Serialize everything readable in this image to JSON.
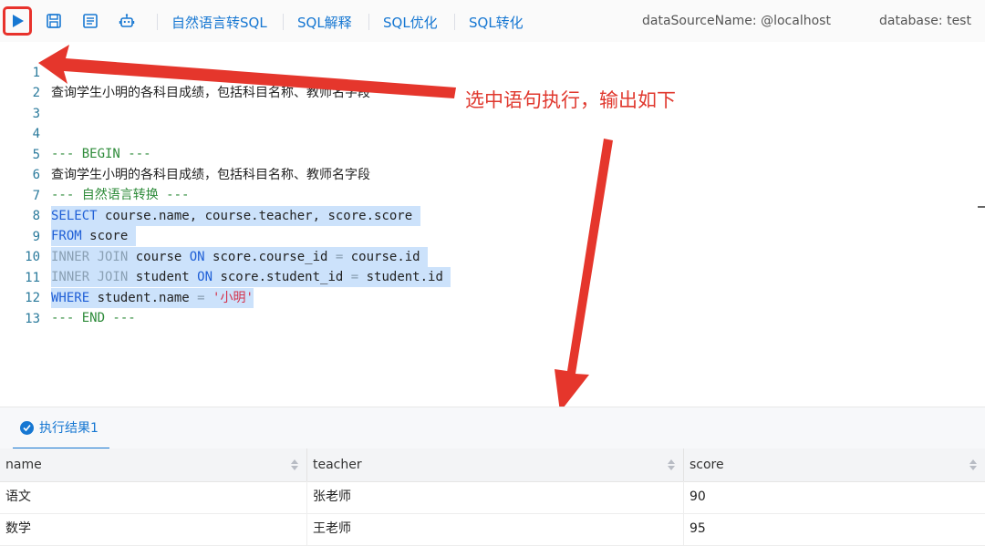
{
  "toolbar": {
    "links": [
      "自然语言转SQL",
      "SQL解释",
      "SQL优化",
      "SQL转化"
    ],
    "datasource": "dataSourceName: @localhost",
    "database": "database: test"
  },
  "editor": {
    "lines": [
      {
        "n": "1",
        "text": "查询学生小明的各科目成绩，包括科目名称、教师名字段"
      },
      {
        "n": "2",
        "text": ""
      },
      {
        "n": "3",
        "text": ""
      },
      {
        "n": "4",
        "text": "--- BEGIN ---"
      },
      {
        "n": "5",
        "text": "查询学生小明的各科目成绩，包括科目名称、教师名字段"
      },
      {
        "n": "6",
        "text": "--- 自然语言转换 ---"
      },
      {
        "n": "7",
        "text": "SELECT course.name, course.teacher, score.score"
      },
      {
        "n": "8",
        "text": "FROM score"
      },
      {
        "n": "9",
        "text": "INNER JOIN course ON score.course_id = course.id"
      },
      {
        "n": "10",
        "text": "INNER JOIN student ON score.student_id = student.id"
      },
      {
        "n": "11",
        "text": "WHERE student.name = '小明'"
      },
      {
        "n": "12",
        "text": "--- END ---"
      },
      {
        "n": "13",
        "text": ""
      }
    ],
    "tokens": {
      "select": "SELECT",
      "select_rest": " course.name, course.teacher, score.score ",
      "from": "FROM",
      "from_rest": " score ",
      "inner1": "INNER JOIN",
      "course": " course ",
      "on1": "ON",
      "on1_rest": " score.course_id ",
      "eq1": "=",
      "eq1_rest": " course.id ",
      "inner2": "INNER JOIN",
      "student": " student ",
      "on2": "ON",
      "on2_rest": " score.student_id ",
      "eq2": "=",
      "eq2_rest": " student.id ",
      "where": "WHERE",
      "where_rest": " student.name ",
      "eq3": "=",
      "str": "'小明'"
    }
  },
  "annotation": {
    "text": "选中语句执行，输出如下"
  },
  "result": {
    "tab_label": "执行结果1",
    "columns": [
      "name",
      "teacher",
      "score"
    ],
    "rows": [
      [
        "语文",
        "张老师",
        "90"
      ],
      [
        "数学",
        "王老师",
        "95"
      ]
    ]
  },
  "colors": {
    "accent": "#1677d2",
    "annotation": "#e0382e",
    "selection": "#cce2fb"
  }
}
